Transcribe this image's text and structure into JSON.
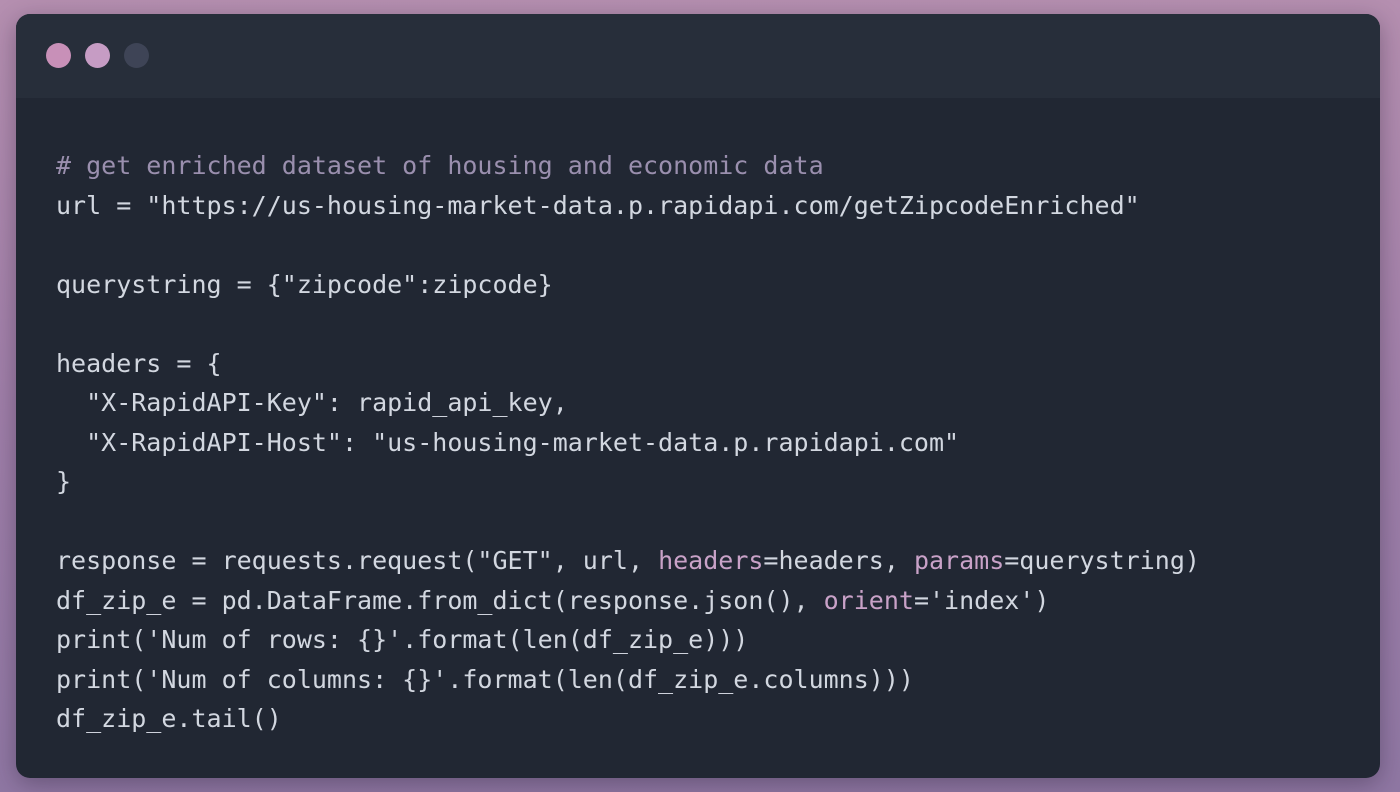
{
  "window": {
    "controls": [
      {
        "name": "close",
        "color": "#c890b8"
      },
      {
        "name": "minimize",
        "color": "#c69cc4"
      },
      {
        "name": "zoom",
        "color": "#3e4456"
      }
    ]
  },
  "code": {
    "lines": [
      [
        {
          "t": "# get enriched dataset of housing and economic data",
          "c": "comment"
        }
      ],
      [
        {
          "t": "url = \"https://us-housing-market-data.p.rapidapi.com/getZipcodeEnriched\"",
          "c": "plain"
        }
      ],
      [],
      [
        {
          "t": "querystring = {\"zipcode\":zipcode}",
          "c": "plain"
        }
      ],
      [],
      [
        {
          "t": "headers = {",
          "c": "plain"
        }
      ],
      [
        {
          "t": "  \"X-RapidAPI-Key\": rapid_api_key,",
          "c": "plain"
        }
      ],
      [
        {
          "t": "  \"X-RapidAPI-Host\": \"us-housing-market-data.p.rapidapi.com\"",
          "c": "plain"
        }
      ],
      [
        {
          "t": "}",
          "c": "plain"
        }
      ],
      [],
      [
        {
          "t": "response = requests.request(\"GET\", url, ",
          "c": "plain"
        },
        {
          "t": "headers",
          "c": "kwarg"
        },
        {
          "t": "=headers, ",
          "c": "plain"
        },
        {
          "t": "params",
          "c": "kwarg"
        },
        {
          "t": "=querystring)",
          "c": "plain"
        }
      ],
      [
        {
          "t": "df_zip_e = pd.DataFrame.from_dict(response.json(), ",
          "c": "plain"
        },
        {
          "t": "orient",
          "c": "kwarg"
        },
        {
          "t": "='index')",
          "c": "plain"
        }
      ],
      [
        {
          "t": "print('Num of rows: {}'.format(len(df_zip_e)))",
          "c": "plain"
        }
      ],
      [
        {
          "t": "print('Num of columns: {}'.format(len(df_zip_e.columns)))",
          "c": "plain"
        }
      ],
      [
        {
          "t": "df_zip_e.tail()",
          "c": "plain"
        }
      ]
    ]
  },
  "colors": {
    "window_bg": "#212733",
    "titlebar_bg": "#272e3a",
    "text": "#d2d7e0",
    "comment": "#9a8fae",
    "kwarg": "#c9a2c8"
  }
}
